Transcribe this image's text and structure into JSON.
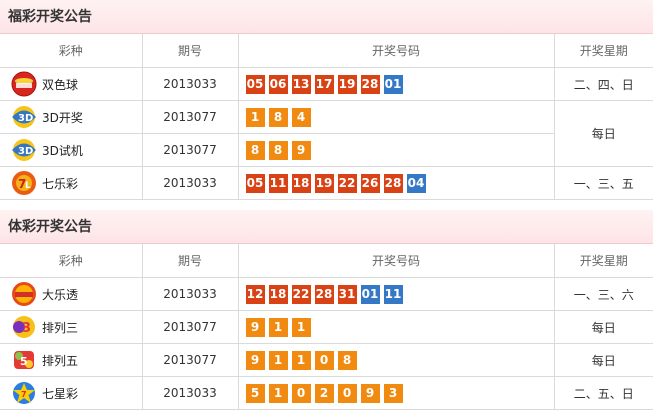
{
  "fc": {
    "title": "福彩开奖公告",
    "headers": {
      "game": "彩种",
      "issue": "期号",
      "numbers": "开奖号码",
      "days": "开奖星期"
    },
    "rows": [
      {
        "name": "双色球",
        "logo": "ssq-logo-icon",
        "issue": "2013033",
        "days": "二、四、日",
        "balls": [
          {
            "n": "05",
            "c": "red"
          },
          {
            "n": "06",
            "c": "red"
          },
          {
            "n": "13",
            "c": "red"
          },
          {
            "n": "17",
            "c": "red"
          },
          {
            "n": "19",
            "c": "red"
          },
          {
            "n": "28",
            "c": "red"
          },
          {
            "n": "01",
            "c": "blue"
          }
        ]
      },
      {
        "name": "3D开奖",
        "logo": "3d-logo-icon",
        "issue": "2013077",
        "days": "每日",
        "balls": [
          {
            "n": "1",
            "c": "orange"
          },
          {
            "n": "8",
            "c": "orange"
          },
          {
            "n": "4",
            "c": "orange"
          }
        ]
      },
      {
        "name": "3D试机",
        "logo": "3d-logo-icon",
        "issue": "2013077",
        "balls": [
          {
            "n": "8",
            "c": "orange"
          },
          {
            "n": "8",
            "c": "orange"
          },
          {
            "n": "9",
            "c": "orange"
          }
        ]
      },
      {
        "name": "七乐彩",
        "logo": "qlc-logo-icon",
        "issue": "2013033",
        "days": "一、三、五",
        "balls": [
          {
            "n": "05",
            "c": "red"
          },
          {
            "n": "11",
            "c": "red"
          },
          {
            "n": "18",
            "c": "red"
          },
          {
            "n": "19",
            "c": "red"
          },
          {
            "n": "22",
            "c": "red"
          },
          {
            "n": "26",
            "c": "red"
          },
          {
            "n": "28",
            "c": "red"
          },
          {
            "n": "04",
            "c": "blue"
          }
        ]
      }
    ]
  },
  "tc": {
    "title": "体彩开奖公告",
    "headers": {
      "game": "彩种",
      "issue": "期号",
      "numbers": "开奖号码",
      "days": "开奖星期"
    },
    "rows": [
      {
        "name": "大乐透",
        "logo": "dlt-logo-icon",
        "issue": "2013033",
        "days": "一、三、六",
        "balls": [
          {
            "n": "12",
            "c": "red"
          },
          {
            "n": "18",
            "c": "red"
          },
          {
            "n": "22",
            "c": "red"
          },
          {
            "n": "28",
            "c": "red"
          },
          {
            "n": "31",
            "c": "red"
          },
          {
            "n": "01",
            "c": "blue"
          },
          {
            "n": "11",
            "c": "blue"
          }
        ]
      },
      {
        "name": "排列三",
        "logo": "pl3-logo-icon",
        "issue": "2013077",
        "days": "每日",
        "balls": [
          {
            "n": "9",
            "c": "orange"
          },
          {
            "n": "1",
            "c": "orange"
          },
          {
            "n": "1",
            "c": "orange"
          }
        ]
      },
      {
        "name": "排列五",
        "logo": "pl5-logo-icon",
        "issue": "2013077",
        "days": "每日",
        "balls": [
          {
            "n": "9",
            "c": "orange"
          },
          {
            "n": "1",
            "c": "orange"
          },
          {
            "n": "1",
            "c": "orange"
          },
          {
            "n": "0",
            "c": "orange"
          },
          {
            "n": "8",
            "c": "orange"
          }
        ]
      },
      {
        "name": "七星彩",
        "logo": "qxc-logo-icon",
        "issue": "2013033",
        "days": "二、五、日",
        "balls": [
          {
            "n": "5",
            "c": "orange"
          },
          {
            "n": "1",
            "c": "orange"
          },
          {
            "n": "0",
            "c": "orange"
          },
          {
            "n": "2",
            "c": "orange"
          },
          {
            "n": "0",
            "c": "orange"
          },
          {
            "n": "9",
            "c": "orange"
          },
          {
            "n": "3",
            "c": "orange"
          }
        ]
      }
    ]
  },
  "colors": {
    "red": "#d84214",
    "blue": "#3579c6",
    "orange": "#f08a10",
    "header_bg": "#fde4e6"
  }
}
